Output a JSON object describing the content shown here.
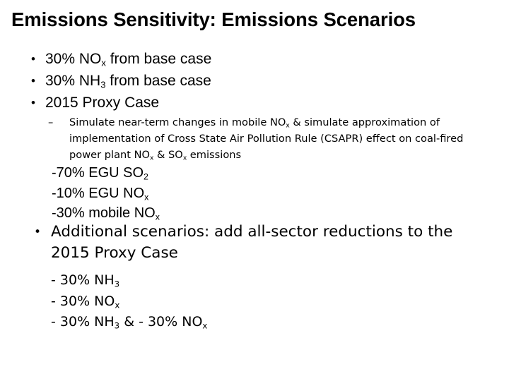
{
  "slide": {
    "title": "Emissions Sensitivity: Emissions Scenarios",
    "background_color": "#ffffff",
    "text_color": "#000000",
    "bullet_glyph": "•",
    "dash_glyph": "–",
    "level1_bullets": [
      {
        "prefix": "30% NO",
        "sub": "x",
        "suffix": " from base case"
      },
      {
        "prefix": "30% NH",
        "sub": "3",
        "suffix": " from base case"
      },
      {
        "prefix": "2015 Proxy Case",
        "sub": "",
        "suffix": ""
      }
    ],
    "sub_paragraph": {
      "marker": "–",
      "part1": "Simulate near-term changes in mobile NO",
      "sub1": "x",
      "part2": " & simulate approximation of implementation of Cross State Air Pollution Rule (CSAPR) effect on coal-fired power plant NO",
      "sub2": "x",
      "part3": " & SO",
      "sub3": "x",
      "part4": " emissions"
    },
    "proxy_detail_lines": [
      {
        "prefix": "-70% EGU SO",
        "sub": "2",
        "suffix": ""
      },
      {
        "prefix": "-10% EGU NO",
        "sub": "x",
        "suffix": ""
      },
      {
        "prefix": "-30% mobile NO",
        "sub": "x",
        "suffix": ""
      }
    ],
    "additional_bullet": {
      "marker": "•",
      "text": "Additional scenarios: add all-sector reductions to the 2015 Proxy Case"
    },
    "additional_lines": [
      {
        "prefix": "- 30% NH",
        "sub": "3",
        "suffix": ""
      },
      {
        "prefix": "- 30% NO",
        "sub": "x",
        "suffix": ""
      },
      {
        "prefix": "- 30% NH",
        "sub": "3",
        "suffix": " & - 30% NO",
        "sub2": "x",
        "suffix2": ""
      }
    ]
  }
}
